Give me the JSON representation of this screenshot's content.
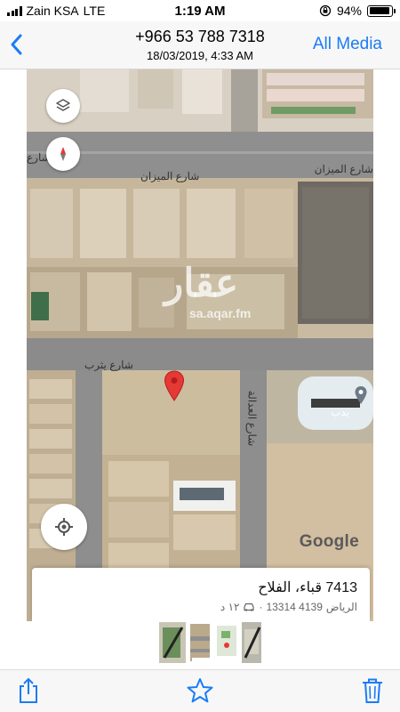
{
  "status_bar": {
    "carrier": "Zain KSA",
    "network": "LTE",
    "time": "1:19 AM",
    "battery_percent": "94%",
    "battery_level": 0.94,
    "icons": [
      "signal-icon",
      "orientation-lock-icon",
      "battery-icon"
    ]
  },
  "nav": {
    "back_icon": "chevron-left-icon",
    "title": "+966 53 788 7318",
    "subtitle": "18/03/2019, 4:33 AM",
    "all_media_label": "All Media"
  },
  "map": {
    "street_top": "شارع الميزان",
    "street_top_right": "شارع الميزان",
    "street_left": "شارع",
    "street_middle": "شارع يثرب",
    "street_vertical": "شارع العدالة",
    "mosque_label": "يدب",
    "watermark_logo": "عقار",
    "watermark_url": "sa.aqar.fm",
    "google_logo": "Google",
    "colors": {
      "land": "#cbbda4",
      "road": "#8e8e8e",
      "pin": "#e53935",
      "mosque_roof": "#e4ecf0"
    },
    "icons": [
      "layers-icon",
      "compass-icon",
      "my-location-icon",
      "map-pin-icon",
      "place-marker-icon"
    ]
  },
  "place_card": {
    "title": "7413 قباء، الفلاح",
    "city": "الرياض",
    "postal": "4139 13314",
    "drive_time": "١٢ د",
    "icons": [
      "car-icon"
    ]
  },
  "thumbnails": {
    "count": 4
  },
  "toolbar": {
    "icons": [
      "share-icon",
      "favorite-star-icon",
      "trash-icon"
    ],
    "accent": "#1a7cf5"
  }
}
